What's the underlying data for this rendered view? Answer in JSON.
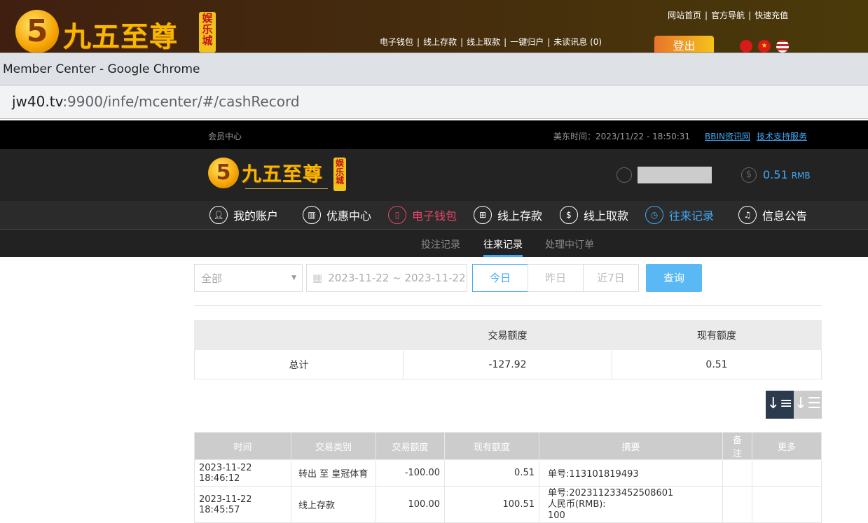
{
  "site_header": {
    "logo_text": "九五至尊",
    "logo_tag": "娱乐城",
    "logo_digit": "5",
    "top_links": [
      "网站首页",
      "官方导航",
      "快速充值"
    ],
    "account_links": [
      "电子钱包",
      "线上存款",
      "线上取款",
      "一键归户",
      "未读讯息 (0)"
    ],
    "logout_label": "登出",
    "flags": [
      "hong-kong",
      "china",
      "usa"
    ]
  },
  "browser": {
    "window_title": "Member Center - Google Chrome",
    "url_host": "jw40.tv",
    "url_rest": ":9900/infe/mcenter/#/cashRecord"
  },
  "topbar": {
    "title": "会员中心",
    "time_label": "美东时间：2023/11/22 - 18:50:31",
    "links": [
      "BBIN资讯网",
      "技术支持服务"
    ]
  },
  "account": {
    "balance": "0.51",
    "currency": "RMB"
  },
  "nav": [
    {
      "label": "我的账户",
      "icon": "user-icon"
    },
    {
      "label": "优惠中心",
      "icon": "gift-icon"
    },
    {
      "label": "电子钱包",
      "icon": "wallet-icon"
    },
    {
      "label": "线上存款",
      "icon": "deposit-icon"
    },
    {
      "label": "线上取款",
      "icon": "withdraw-icon"
    },
    {
      "label": "往来记录",
      "icon": "record-icon"
    },
    {
      "label": "信息公告",
      "icon": "bell-icon"
    }
  ],
  "colors": {
    "wallet": "#e8456b",
    "active": "#3fa9f5",
    "query": "#5ab8f5",
    "sort_active": "#2c3a4e"
  },
  "subnav": [
    "投注记录",
    "往来记录",
    "处理中订单"
  ],
  "filter": {
    "type": "全部",
    "date_range": "2023-11-22 ~ 2023-11-22",
    "quick": [
      "今日",
      "昨日",
      "近7日"
    ],
    "query": "查询"
  },
  "summary": {
    "headers": [
      "",
      "交易额度",
      "现有额度"
    ],
    "row": [
      "总计",
      "-127.92",
      "0.51"
    ]
  },
  "records": {
    "headers": [
      "时间",
      "交易类别",
      "交易额度",
      "现有额度",
      "摘要",
      "备注",
      "更多"
    ],
    "rows": [
      {
        "time": "2023-11-22 18:46:12",
        "type": "转出 至 皇冠体育",
        "amount": "-100.00",
        "balance": "0.51",
        "summary": [
          "单号:113101819493"
        ],
        "note": "",
        "more": ""
      },
      {
        "time": "2023-11-22 18:45:57",
        "type": "线上存款",
        "amount": "100.00",
        "balance": "100.51",
        "summary": [
          "单号:202311233452508601",
          "人民币(RMB):",
          "100"
        ],
        "note": "",
        "more": ""
      }
    ]
  }
}
